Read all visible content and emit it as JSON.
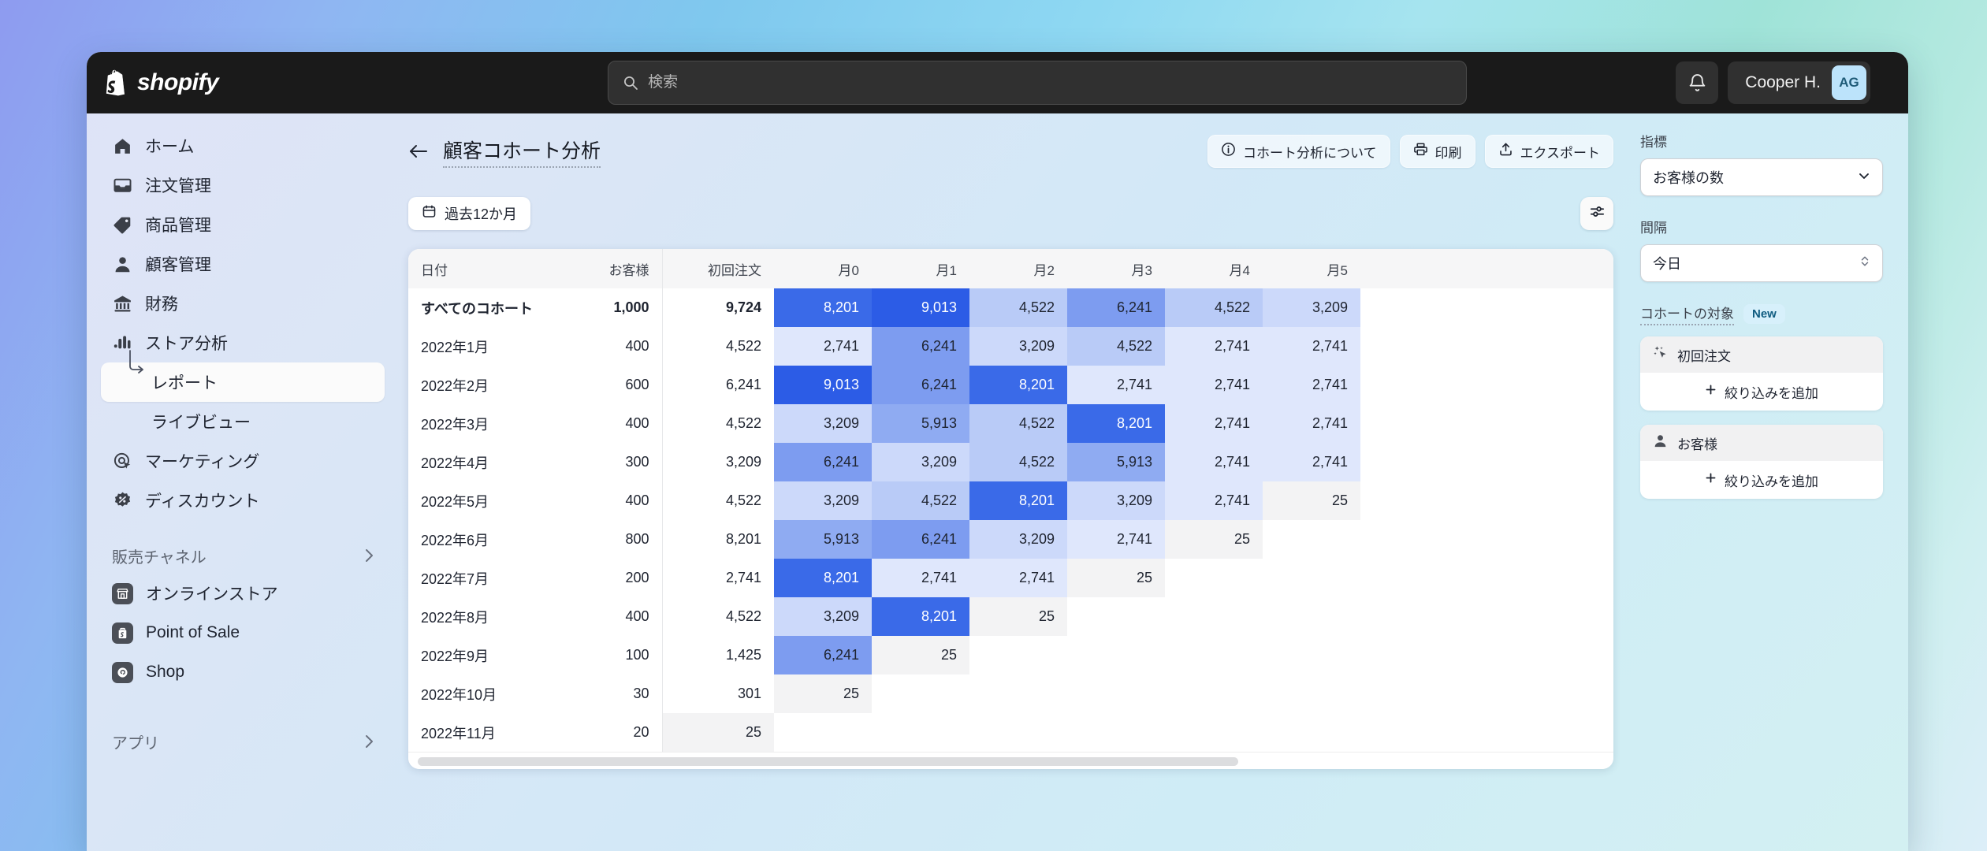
{
  "brand": {
    "name": "shopify"
  },
  "topbar": {
    "search_placeholder": "検索",
    "user_name": "Cooper H.",
    "avatar_initials": "AG"
  },
  "sidebar": {
    "items": [
      {
        "label": "ホーム",
        "icon": "home-icon"
      },
      {
        "label": "注文管理",
        "icon": "orders-icon"
      },
      {
        "label": "商品管理",
        "icon": "products-icon"
      },
      {
        "label": "顧客管理",
        "icon": "customers-icon"
      },
      {
        "label": "財務",
        "icon": "finance-icon"
      },
      {
        "label": "ストア分析",
        "icon": "analytics-icon"
      },
      {
        "label": "レポート",
        "icon": "report-icon",
        "sub": true,
        "active": true
      },
      {
        "label": "ライブビュー",
        "icon": "liveview-icon",
        "sub": true
      },
      {
        "label": "マーケティング",
        "icon": "marketing-icon"
      },
      {
        "label": "ディスカウント",
        "icon": "discount-icon"
      }
    ],
    "sales_channels_label": "販売チャネル",
    "channels": [
      {
        "label": "オンラインストア",
        "icon": "online-store-icon"
      },
      {
        "label": "Point of Sale",
        "icon": "pos-icon"
      },
      {
        "label": "Shop",
        "icon": "shop-icon"
      }
    ],
    "apps_label": "アプリ"
  },
  "page": {
    "title": "顧客コホート分析",
    "actions": [
      {
        "label": "コホート分析について",
        "icon": "info-icon"
      },
      {
        "label": "印刷",
        "icon": "print-icon"
      },
      {
        "label": "エクスポート",
        "icon": "export-icon"
      }
    ],
    "date_range": "過去12か月",
    "filter_icon": "sliders-icon"
  },
  "right_panel": {
    "metric_label": "指標",
    "metric_value": "お客様の数",
    "interval_label": "間隔",
    "interval_value": "今日",
    "cohort_target_label": "コホートの対象",
    "new_badge": "New",
    "filter_groups": [
      {
        "title": "初回注文",
        "icon": "sparkle-click-icon",
        "add_label": "絞り込みを追加"
      },
      {
        "title": "お客様",
        "icon": "person-icon",
        "add_label": "絞り込みを追加"
      }
    ]
  },
  "chart_data": {
    "type": "heatmap",
    "title": "顧客コホート分析",
    "xlabel": "",
    "ylabel": "",
    "metric": "お客様の数",
    "columns": [
      "日付",
      "お客様",
      "初回注文",
      "月0",
      "月1",
      "月2",
      "月3",
      "月4",
      "月5"
    ],
    "empty_cell_label": "25",
    "value_color_scale": {
      "9013": "#2c5ce6",
      "8201": "#3a6ae8",
      "6241": "#7d9cf0",
      "5913": "#8fabf2",
      "4522": "#b9cbf7",
      "3209": "#ccd9fa",
      "2741": "#dfe7fc"
    },
    "rows": [
      {
        "date": "すべてのコホート",
        "customers": "1,000",
        "first_order": "9,724",
        "total": true,
        "months": [
          {
            "v": "8,201",
            "n": 8201
          },
          {
            "v": "9,013",
            "n": 9013
          },
          {
            "v": "4,522",
            "n": 4522
          },
          {
            "v": "6,241",
            "n": 6241
          },
          {
            "v": "4,522",
            "n": 4522
          },
          {
            "v": "3,209",
            "n": 3209
          }
        ]
      },
      {
        "date": "2022年1月",
        "customers": "400",
        "first_order": "4,522",
        "months": [
          {
            "v": "2,741",
            "n": 2741
          },
          {
            "v": "6,241",
            "n": 6241
          },
          {
            "v": "3,209",
            "n": 3209
          },
          {
            "v": "4,522",
            "n": 4522
          },
          {
            "v": "2,741",
            "n": 2741
          },
          {
            "v": "2,741",
            "n": 2741
          }
        ]
      },
      {
        "date": "2022年2月",
        "customers": "600",
        "first_order": "6,241",
        "months": [
          {
            "v": "9,013",
            "n": 9013
          },
          {
            "v": "6,241",
            "n": 6241
          },
          {
            "v": "8,201",
            "n": 8201
          },
          {
            "v": "2,741",
            "n": 2741
          },
          {
            "v": "2,741",
            "n": 2741
          },
          {
            "v": "2,741",
            "n": 2741
          }
        ]
      },
      {
        "date": "2022年3月",
        "customers": "400",
        "first_order": "4,522",
        "months": [
          {
            "v": "3,209",
            "n": 3209
          },
          {
            "v": "5,913",
            "n": 5913
          },
          {
            "v": "4,522",
            "n": 4522
          },
          {
            "v": "8,201",
            "n": 8201
          },
          {
            "v": "2,741",
            "n": 2741
          },
          {
            "v": "2,741",
            "n": 2741
          }
        ]
      },
      {
        "date": "2022年4月",
        "customers": "300",
        "first_order": "3,209",
        "months": [
          {
            "v": "6,241",
            "n": 6241
          },
          {
            "v": "3,209",
            "n": 3209
          },
          {
            "v": "4,522",
            "n": 4522
          },
          {
            "v": "5,913",
            "n": 5913
          },
          {
            "v": "2,741",
            "n": 2741
          },
          {
            "v": "2,741",
            "n": 2741
          }
        ]
      },
      {
        "date": "2022年5月",
        "customers": "400",
        "first_order": "4,522",
        "months": [
          {
            "v": "3,209",
            "n": 3209
          },
          {
            "v": "4,522",
            "n": 4522
          },
          {
            "v": "8,201",
            "n": 8201
          },
          {
            "v": "3,209",
            "n": 3209
          },
          {
            "v": "2,741",
            "n": 2741
          },
          {
            "v": "25",
            "empty": true
          }
        ]
      },
      {
        "date": "2022年6月",
        "customers": "800",
        "first_order": "8,201",
        "months": [
          {
            "v": "5,913",
            "n": 5913
          },
          {
            "v": "6,241",
            "n": 6241
          },
          {
            "v": "3,209",
            "n": 3209
          },
          {
            "v": "2,741",
            "n": 2741
          },
          {
            "v": "25",
            "empty": true
          },
          {
            "v": "",
            "blank": true
          }
        ]
      },
      {
        "date": "2022年7月",
        "customers": "200",
        "first_order": "2,741",
        "months": [
          {
            "v": "8,201",
            "n": 8201
          },
          {
            "v": "2,741",
            "n": 2741
          },
          {
            "v": "2,741",
            "n": 2741
          },
          {
            "v": "25",
            "empty": true
          },
          {
            "v": "",
            "blank": true
          },
          {
            "v": "",
            "blank": true
          }
        ]
      },
      {
        "date": "2022年8月",
        "customers": "400",
        "first_order": "4,522",
        "months": [
          {
            "v": "3,209",
            "n": 3209
          },
          {
            "v": "8,201",
            "n": 8201
          },
          {
            "v": "25",
            "empty": true
          },
          {
            "v": "",
            "blank": true
          },
          {
            "v": "",
            "blank": true
          },
          {
            "v": "",
            "blank": true
          }
        ]
      },
      {
        "date": "2022年9月",
        "customers": "100",
        "first_order": "1,425",
        "months": [
          {
            "v": "6,241",
            "n": 6241
          },
          {
            "v": "25",
            "empty": true
          },
          {
            "v": "",
            "blank": true
          },
          {
            "v": "",
            "blank": true
          },
          {
            "v": "",
            "blank": true
          },
          {
            "v": "",
            "blank": true
          }
        ]
      },
      {
        "date": "2022年10月",
        "customers": "30",
        "first_order": "301",
        "months": [
          {
            "v": "25",
            "empty": true
          },
          {
            "v": "",
            "blank": true
          },
          {
            "v": "",
            "blank": true
          },
          {
            "v": "",
            "blank": true
          },
          {
            "v": "",
            "blank": true
          },
          {
            "v": "",
            "blank": true
          }
        ]
      },
      {
        "date": "2022年11月",
        "customers": "20",
        "first_order": "25",
        "muted_row": true,
        "months": [
          {
            "v": "",
            "blank": true
          },
          {
            "v": "",
            "blank": true
          },
          {
            "v": "",
            "blank": true
          },
          {
            "v": "",
            "blank": true
          },
          {
            "v": "",
            "blank": true
          },
          {
            "v": "",
            "blank": true
          }
        ]
      }
    ]
  }
}
